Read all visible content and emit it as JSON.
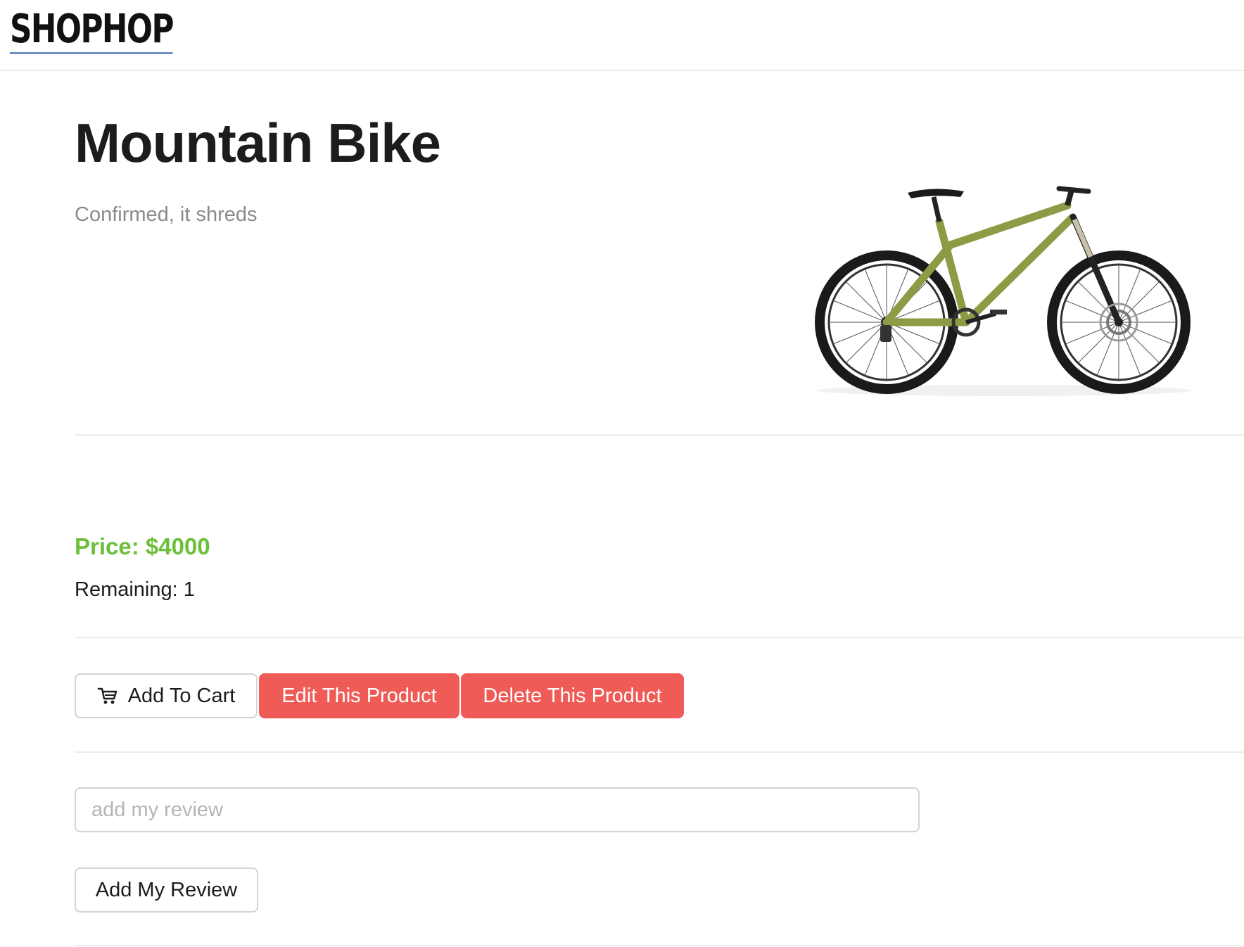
{
  "header": {
    "logo_text": "SHOPHOP"
  },
  "product": {
    "title": "Mountain Bike",
    "description": "Confirmed, it shreds",
    "price_label": "Price: $4000",
    "remaining_label": "Remaining: 1",
    "image_icon": "bicycle-image",
    "frame_color": "#8f9a45"
  },
  "actions": {
    "add_to_cart_label": "Add To Cart",
    "add_to_cart_icon": "cart-icon",
    "edit_label": "Edit This Product",
    "delete_label": "Delete This Product"
  },
  "review": {
    "input_placeholder": "add my review",
    "input_value": "",
    "submit_label": "Add My Review"
  },
  "colors": {
    "price": "#6bbf3a",
    "danger_button": "#ef5b57",
    "logo_underline": "#6f8fc7"
  }
}
